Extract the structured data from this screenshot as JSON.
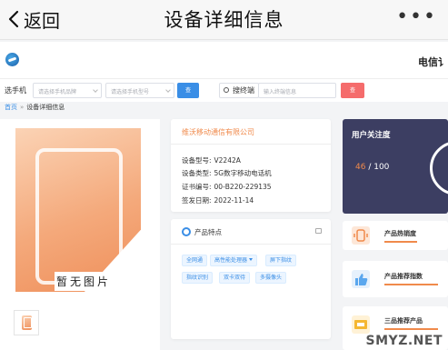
{
  "navbar": {
    "back_label": "返回",
    "title": "设备详细信息",
    "more_label": "•••"
  },
  "site": {
    "name": "电信讠"
  },
  "filter": {
    "phone_label": "选手机",
    "brand_placeholder": "请选择手机品牌",
    "model_placeholder": "请选择手机型号",
    "search_button": "查",
    "terminal_label": "搜终端",
    "terminal_placeholder": "输入终端信息",
    "reset_button": "查"
  },
  "breadcrumb": {
    "home": "首页",
    "separator": "»",
    "current": "设备详细信息"
  },
  "product": {
    "no_image": "暂无图片",
    "company": "维沃移动通信有限公司",
    "rows": [
      {
        "key": "设备型号:",
        "value": "V2242A"
      },
      {
        "key": "设备类型:",
        "value": "5G数字移动电话机"
      },
      {
        "key": "证书编号:",
        "value": "00-B220-229135"
      },
      {
        "key": "签发日期:",
        "value": "2022-11-14"
      }
    ]
  },
  "features": {
    "title": "产品特点",
    "tags": [
      {
        "label": "全网通",
        "dropdown": false
      },
      {
        "label": "高性能处理器",
        "dropdown": true
      },
      {
        "label": "屏下指纹",
        "dropdown": false
      },
      {
        "label": "指纹识别",
        "dropdown": false
      },
      {
        "label": "双卡双待",
        "dropdown": false
      },
      {
        "label": "多摄像头",
        "dropdown": false
      }
    ]
  },
  "attention": {
    "title": "用户关注度",
    "score": "46",
    "total": "/ 100"
  },
  "stats": [
    {
      "label": "产品热销度",
      "icon": "sales-icon",
      "bar": 0.55
    },
    {
      "label": "产品推荐指数",
      "icon": "thumbs-up-icon",
      "bar": 0.9
    },
    {
      "label": "三品推荐产品",
      "icon": "product-icon",
      "bar": 0.9
    }
  ],
  "watermark": "SMYZ.NET",
  "colors": {
    "accent": "#3a8ee6",
    "orange": "#f08a4b",
    "danger": "#f56c6c",
    "dark_card": "#3c3e62"
  }
}
